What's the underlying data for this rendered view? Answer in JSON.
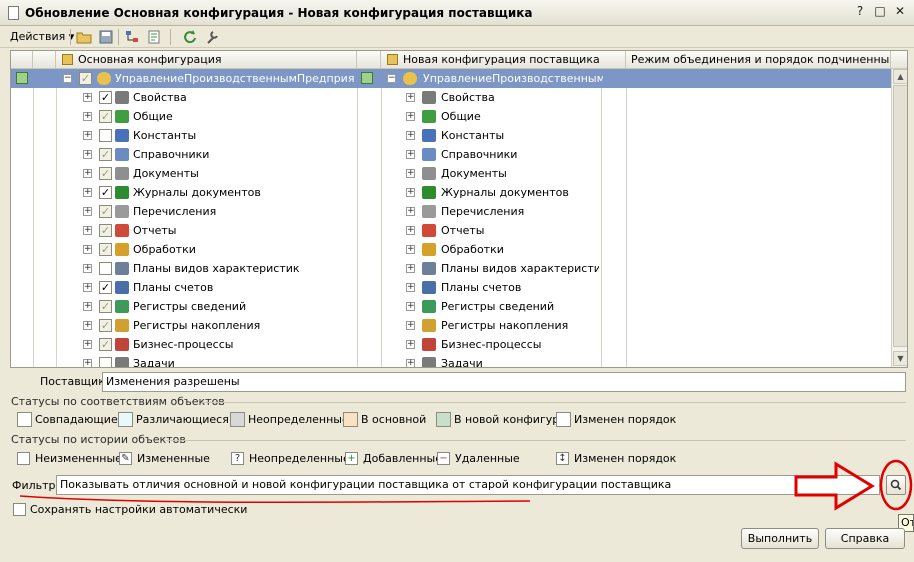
{
  "window": {
    "title": "Обновление Основная конфигурация - Новая конфигурация поставщика",
    "help_btn": "?",
    "max_btn": "□",
    "close_btn": "✕"
  },
  "toolbar": {
    "actions_label": "Действия"
  },
  "tree": {
    "columns": {
      "main": "Основная конфигурация",
      "vendor": "Новая конфигурация поставщика",
      "mode": "Режим объединения и порядок подчиненных об..."
    },
    "root": {
      "left": "УправлениеПроизводственнымПредприяти...",
      "right": "УправлениеПроизводственным..."
    },
    "items": [
      {
        "label": "Свойства",
        "check": "✓",
        "checked_style": "black",
        "icon": "#7a7a7a"
      },
      {
        "label": "Общие",
        "check": "✓",
        "checked_style": "gray",
        "icon": "#3f9e3f"
      },
      {
        "label": "Константы",
        "check": "",
        "checked_style": "none",
        "icon": "#4a72b8"
      },
      {
        "label": "Справочники",
        "check": "✓",
        "checked_style": "gray",
        "icon": "#6b8cc2"
      },
      {
        "label": "Документы",
        "check": "✓",
        "checked_style": "gray",
        "icon": "#8f8f8f"
      },
      {
        "label": "Журналы документов",
        "check": "✓",
        "checked_style": "black",
        "icon": "#2e8c2e"
      },
      {
        "label": "Перечисления",
        "check": "✓",
        "checked_style": "gray",
        "icon": "#9a9a9a"
      },
      {
        "label": "Отчеты",
        "check": "✓",
        "checked_style": "gray",
        "icon": "#d04a3a"
      },
      {
        "label": "Обработки",
        "check": "✓",
        "checked_style": "gray",
        "icon": "#d6a12a"
      },
      {
        "label": "Планы видов характеристик",
        "check": "",
        "checked_style": "none",
        "icon": "#6e7f99"
      },
      {
        "label": "Планы счетов",
        "check": "✓",
        "checked_style": "black",
        "icon": "#4a6ea8"
      },
      {
        "label": "Регистры сведений",
        "check": "✓",
        "checked_style": "gray",
        "icon": "#3e9a5a"
      },
      {
        "label": "Регистры накопления",
        "check": "✓",
        "checked_style": "gray",
        "icon": "#d0a030"
      },
      {
        "label": "Бизнес-процессы",
        "check": "✓",
        "checked_style": "gray",
        "icon": "#c0443a"
      },
      {
        "label": "Задачи",
        "check": "",
        "checked_style": "none",
        "icon": "#7a7a7a"
      }
    ]
  },
  "supplier": {
    "label": "Поставщик:",
    "value": "Изменения разрешены"
  },
  "status_match": {
    "title": "Статусы по соответствиям объектов",
    "items": [
      {
        "label": "Совпадающие",
        "color": "#ffffff"
      },
      {
        "label": "Различающиеся",
        "color": "#e8f8fb"
      },
      {
        "label": "Неопределенные",
        "color": "#d8d8d8"
      },
      {
        "label": "В основной",
        "color": "#fbe1c4"
      },
      {
        "label": "В новой конфигур...",
        "color": "#c9dfc9"
      },
      {
        "label": "Изменен порядок",
        "color": "#ffffff"
      }
    ]
  },
  "status_history": {
    "title": "Статусы по истории объектов",
    "items": [
      {
        "label": "Неизмененные",
        "glyph": ""
      },
      {
        "label": "Измененные",
        "glyph": "✎"
      },
      {
        "label": "Неопределенные",
        "glyph": "?"
      },
      {
        "label": "Добавленные",
        "glyph": "+"
      },
      {
        "label": "Удаленные",
        "glyph": "−"
      },
      {
        "label": "Изменен порядок",
        "glyph": "↕"
      }
    ]
  },
  "filter": {
    "label": "Фильтр:",
    "value": "Показывать отличия основной и новой конфигурации поставщика от старой конфигурации поставщика",
    "tooltip": "От"
  },
  "autosave": {
    "label": "Сохранять настройки автоматически"
  },
  "buttons": {
    "run": "Выполнить",
    "help": "Справка"
  },
  "colors": {
    "selection": "#7c97c6",
    "annotation": "#e00000",
    "window_bg": "#ece9d8"
  }
}
